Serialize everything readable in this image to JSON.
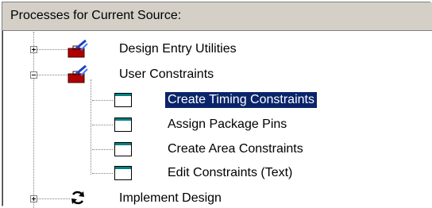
{
  "header": {
    "title": "Processes for Current Source:"
  },
  "tree": {
    "items": [
      {
        "label": "Design Entry Utilities",
        "icon": "toolbox-icon",
        "expander": "plus"
      },
      {
        "label": "User Constraints",
        "icon": "toolbox-icon",
        "expander": "minus"
      },
      {
        "label": "Create Timing Constraints",
        "icon": "document-icon",
        "selected": true
      },
      {
        "label": "Assign Package Pins",
        "icon": "document-icon"
      },
      {
        "label": "Create Area Constraints",
        "icon": "document-icon"
      },
      {
        "label": "Edit Constraints (Text)",
        "icon": "document-icon"
      },
      {
        "label": "Implement Design",
        "icon": "refresh-icon",
        "expander": "plus"
      }
    ]
  },
  "colors": {
    "header_bg": "#d4d0c8",
    "selection_bg": "#0a246a",
    "doc_accent": "#008080"
  }
}
